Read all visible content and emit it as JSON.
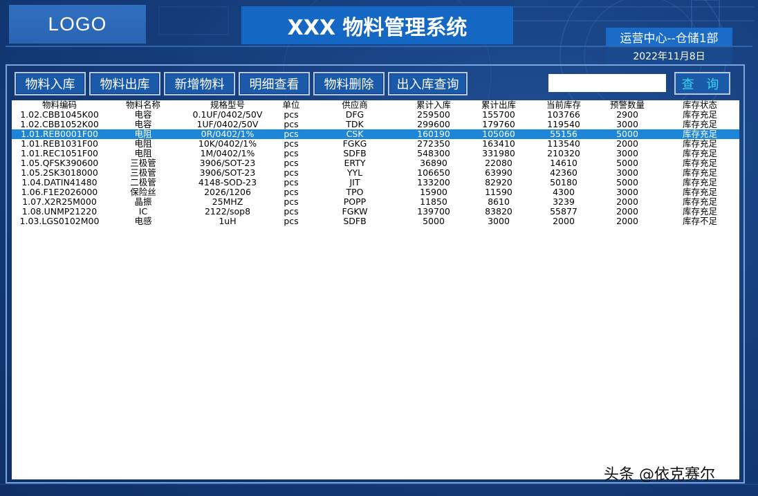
{
  "header": {
    "logo": "LOGO",
    "title": "XXX 物料管理系统",
    "department": "运营中心--仓储1部",
    "date": "2022年11月8日"
  },
  "toolbar": {
    "buttons": [
      "物料入库",
      "物料出库",
      "新增物料",
      "明细查看",
      "物料删除",
      "出入库查询"
    ],
    "search_value": "",
    "search_button": "查 询"
  },
  "table": {
    "columns": [
      "物料编码",
      "物料名称",
      "规格型号",
      "单位",
      "供应商",
      "累计入库",
      "累计出库",
      "当前库存",
      "预警数量",
      "库存状态"
    ],
    "selected_row": 2,
    "rows": [
      [
        "1.02.CBB1045K00",
        "电容",
        "0.1UF/0402/50V",
        "pcs",
        "DFG",
        "259500",
        "155700",
        "103766",
        "2900",
        "库存充足"
      ],
      [
        "1.02.CBB1052K00",
        "电容",
        "1UF/0402/50V",
        "pcs",
        "TDK",
        "299600",
        "179760",
        "119540",
        "3000",
        "库存充足"
      ],
      [
        "1.01.REB0001F00",
        "电阻",
        "0R/0402/1%",
        "pcs",
        "CSK",
        "160190",
        "105060",
        "55156",
        "5000",
        "库存充足"
      ],
      [
        "1.01.REB1031F00",
        "电阻",
        "10K/0402/1%",
        "pcs",
        "FGKG",
        "272350",
        "163410",
        "113540",
        "2000",
        "库存充足"
      ],
      [
        "1.01.REC1051F00",
        "电阻",
        "1M/0402/1%",
        "pcs",
        "SDFB",
        "548300",
        "331980",
        "210320",
        "3000",
        "库存充足"
      ],
      [
        "1.05.QFSK390600",
        "三极管",
        "3906/SOT-23",
        "pcs",
        "ERTY",
        "36890",
        "22080",
        "14610",
        "5000",
        "库存充足"
      ],
      [
        "1.05.2SK3018000",
        "三极管",
        "3906/SOT-23",
        "pcs",
        "YYL",
        "106650",
        "63990",
        "42360",
        "3000",
        "库存充足"
      ],
      [
        "1.04.DATIN41480",
        "二极管",
        "4148-SOD-23",
        "pcs",
        "JIT",
        "133200",
        "82920",
        "50180",
        "5000",
        "库存充足"
      ],
      [
        "1.06.F1E2026000",
        "保险丝",
        "2026/1206",
        "pcs",
        "TPO",
        "15900",
        "11590",
        "4300",
        "3000",
        "库存充足"
      ],
      [
        "1.07.X2R25M000",
        "晶振",
        "25MHZ",
        "pcs",
        "POPP",
        "11850",
        "8610",
        "3239",
        "2000",
        "库存充足"
      ],
      [
        "1.08.UNMP21220",
        "IC",
        "2122/sop8",
        "pcs",
        "FGKW",
        "139700",
        "83820",
        "55877",
        "2000",
        "库存充足"
      ],
      [
        "1.03.LGS0102M00",
        "电感",
        "1uH",
        "pcs",
        "SDFB",
        "5000",
        "3000",
        "2000",
        "2000",
        "库存不足"
      ]
    ]
  },
  "watermark": "头条 @依克赛尔"
}
